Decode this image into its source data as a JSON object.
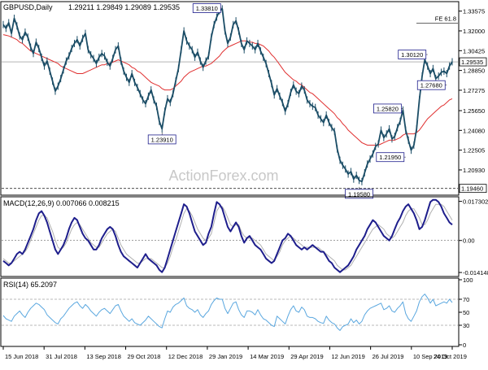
{
  "chart_data": [
    {
      "type": "line",
      "panel": "price",
      "title": "GBPUSD,Daily",
      "ohlc_text": "1.29211 1.29849 1.29089 1.29535",
      "watermark": "ActionForex.com",
      "ylim": [
        1.1905,
        1.342
      ],
      "y_ticks": [
        "1.33575",
        "1.32000",
        "1.30425",
        "1.28850",
        "1.27275",
        "1.25650",
        "1.24080",
        "1.22505",
        "1.20930",
        "1.19460"
      ],
      "y_tick_values": [
        1.33575,
        1.32,
        1.30425,
        1.2885,
        1.27275,
        1.2565,
        1.2408,
        1.22505,
        1.2093,
        1.1946
      ],
      "last_price_label": "1.29535",
      "last_price": 1.29535,
      "support_level": 1.1946,
      "fe_label": "FE 61.8",
      "fe_level": 1.3262,
      "callouts": [
        {
          "label": "1.33810",
          "value": 1.3381,
          "index": 80
        },
        {
          "label": "1.23910",
          "value": 1.2391,
          "index": 58
        },
        {
          "label": "1.30120",
          "value": 1.3012,
          "index": 155
        },
        {
          "label": "1.27680",
          "value": 1.2768,
          "index": 162
        },
        {
          "label": "1.25820",
          "value": 1.2582,
          "index": 146
        },
        {
          "label": "1.21950",
          "value": 1.2195,
          "index": 147
        },
        {
          "label": "1.19580",
          "value": 1.1958,
          "index": 130
        }
      ],
      "series": [
        {
          "role": "price",
          "values": [
            1.325,
            1.322,
            1.3265,
            1.318,
            1.33,
            1.324,
            1.316,
            1.313,
            1.319,
            1.315,
            1.307,
            1.302,
            1.311,
            1.306,
            1.299,
            1.292,
            1.296,
            1.288,
            1.28,
            1.272,
            1.276,
            1.282,
            1.289,
            1.296,
            1.3,
            1.306,
            1.31,
            1.313,
            1.308,
            1.314,
            1.318,
            1.305,
            1.301,
            1.298,
            1.294,
            1.299,
            1.302,
            1.3,
            1.295,
            1.292,
            1.298,
            1.305,
            1.308,
            1.296,
            1.288,
            1.283,
            1.279,
            1.286,
            1.279,
            1.275,
            1.27,
            1.265,
            1.262,
            1.268,
            1.273,
            1.265,
            1.26,
            1.248,
            1.242,
            1.256,
            1.266,
            1.263,
            1.27,
            1.28,
            1.29,
            1.305,
            1.32,
            1.312,
            1.308,
            1.305,
            1.299,
            1.303,
            1.296,
            1.291,
            1.296,
            1.3,
            1.315,
            1.325,
            1.331,
            1.336,
            1.3375,
            1.32,
            1.31,
            1.315,
            1.325,
            1.328,
            1.32,
            1.31,
            1.305,
            1.312,
            1.31,
            1.308,
            1.305,
            1.31,
            1.304,
            1.299,
            1.294,
            1.286,
            1.278,
            1.269,
            1.274,
            1.268,
            1.263,
            1.256,
            1.262,
            1.271,
            1.277,
            1.272,
            1.27,
            1.276,
            1.273,
            1.265,
            1.262,
            1.26,
            1.259,
            1.253,
            1.25,
            1.247,
            1.253,
            1.247,
            1.243,
            1.24,
            1.226,
            1.217,
            1.213,
            1.21,
            1.206,
            1.208,
            1.202,
            1.205,
            1.201,
            1.2,
            1.207,
            1.214,
            1.218,
            1.222,
            1.228,
            1.23,
            1.241,
            1.235,
            1.238,
            1.242,
            1.234,
            1.236,
            1.243,
            1.248,
            1.257,
            1.241,
            1.233,
            1.225,
            1.229,
            1.242,
            1.265,
            1.284,
            1.297,
            1.292,
            1.286,
            1.29,
            1.282,
            1.284,
            1.287,
            1.288,
            1.286,
            1.292,
            1.2954
          ]
        },
        {
          "role": "moving-average",
          "values": [
            1.317,
            1.3165,
            1.316,
            1.315,
            1.314,
            1.313,
            1.311,
            1.31,
            1.308,
            1.306,
            1.304,
            1.303,
            1.302,
            1.301,
            1.3,
            1.299,
            1.298,
            1.297,
            1.296,
            1.295,
            1.294,
            1.292,
            1.291,
            1.29,
            1.289,
            1.288,
            1.287,
            1.286,
            1.286,
            1.286,
            1.287,
            1.288,
            1.289,
            1.29,
            1.291,
            1.292,
            1.293,
            1.293,
            1.294,
            1.294,
            1.295,
            1.296,
            1.297,
            1.296,
            1.295,
            1.294,
            1.293,
            1.291,
            1.29,
            1.288,
            1.287,
            1.285,
            1.283,
            1.281,
            1.279,
            1.278,
            1.277,
            1.276,
            1.274,
            1.273,
            1.273,
            1.273,
            1.274,
            1.276,
            1.278,
            1.28,
            1.283,
            1.285,
            1.287,
            1.288,
            1.289,
            1.29,
            1.291,
            1.292,
            1.292,
            1.293,
            1.294,
            1.296,
            1.298,
            1.3,
            1.303,
            1.305,
            1.307,
            1.308,
            1.309,
            1.31,
            1.311,
            1.312,
            1.312,
            1.312,
            1.311,
            1.311,
            1.31,
            1.31,
            1.309,
            1.308,
            1.306,
            1.304,
            1.301,
            1.299,
            1.296,
            1.293,
            1.29,
            1.287,
            1.285,
            1.283,
            1.281,
            1.28,
            1.278,
            1.277,
            1.275,
            1.273,
            1.271,
            1.27,
            1.268,
            1.266,
            1.264,
            1.262,
            1.26,
            1.258,
            1.256,
            1.254,
            1.251,
            1.249,
            1.246,
            1.244,
            1.241,
            1.239,
            1.237,
            1.235,
            1.233,
            1.231,
            1.23,
            1.229,
            1.229,
            1.229,
            1.229,
            1.229,
            1.23,
            1.231,
            1.232,
            1.233,
            1.233,
            1.233,
            1.234,
            1.235,
            1.237,
            1.238,
            1.238,
            1.238,
            1.238,
            1.239,
            1.241,
            1.244,
            1.247,
            1.25,
            1.252,
            1.254,
            1.256,
            1.258,
            1.26,
            1.261,
            1.263,
            1.265,
            1.266
          ]
        }
      ]
    },
    {
      "type": "line",
      "panel": "macd",
      "title": "MACD(12,26,9) 0.007066 0.008215",
      "ylim": [
        -0.0152,
        0.0186
      ],
      "y_ticks": [
        "0.017302",
        "0.00",
        "-0.014148"
      ],
      "y_tick_values": [
        0.017302,
        0.0,
        -0.014148
      ],
      "series": [
        {
          "role": "macd",
          "values": [
            -0.009,
            -0.01,
            -0.011,
            -0.01,
            -0.008,
            -0.006,
            -0.005,
            -0.006,
            -0.004,
            -0.001,
            0.002,
            0.005,
            0.009,
            0.012,
            0.013,
            0.011,
            0.008,
            0.004,
            0.0,
            -0.004,
            -0.006,
            -0.004,
            -0.002,
            0.001,
            0.005,
            0.008,
            0.01,
            0.009,
            0.006,
            0.003,
            0.001,
            0.0,
            -0.002,
            -0.004,
            -0.004,
            -0.002,
            0.001,
            0.003,
            0.005,
            0.006,
            0.005,
            0.002,
            -0.002,
            -0.005,
            -0.007,
            -0.008,
            -0.009,
            -0.01,
            -0.011,
            -0.012,
            -0.01,
            -0.008,
            -0.006,
            -0.008,
            -0.009,
            -0.01,
            -0.011,
            -0.013,
            -0.014,
            -0.012,
            -0.008,
            -0.004,
            0.0,
            0.004,
            0.008,
            0.012,
            0.016,
            0.015,
            0.012,
            0.008,
            0.004,
            0.002,
            0.0,
            -0.002,
            -0.001,
            0.003,
            0.006,
            0.012,
            0.017,
            0.016,
            0.014,
            0.01,
            0.006,
            0.004,
            0.006,
            0.008,
            0.006,
            0.002,
            -0.001,
            0.001,
            0.002,
            0.0,
            -0.002,
            -0.003,
            -0.004,
            -0.006,
            -0.008,
            -0.009,
            -0.01,
            -0.009,
            -0.006,
            -0.003,
            0.0,
            0.001,
            0.003,
            0.002,
            0.0,
            -0.002,
            -0.003,
            -0.004,
            -0.003,
            -0.004,
            -0.003,
            -0.002,
            -0.003,
            -0.004,
            -0.005,
            -0.005,
            -0.007,
            -0.009,
            -0.01,
            -0.012,
            -0.013,
            -0.014,
            -0.013,
            -0.012,
            -0.011,
            -0.009,
            -0.007,
            -0.004,
            -0.002,
            0.0,
            0.002,
            0.005,
            0.007,
            0.009,
            0.008,
            0.006,
            0.004,
            0.002,
            0.001,
            0.0,
            0.002,
            0.005,
            0.008,
            0.01,
            0.013,
            0.015,
            0.016,
            0.014,
            0.012,
            0.009,
            0.005,
            0.006,
            0.009,
            0.013,
            0.017,
            0.018,
            0.018,
            0.017,
            0.015,
            0.012,
            0.01,
            0.008,
            0.007
          ]
        },
        {
          "role": "signal",
          "values": [
            -0.008,
            -0.009,
            -0.01,
            -0.01,
            -0.009,
            -0.008,
            -0.007,
            -0.006,
            -0.005,
            -0.003,
            0.0,
            0.003,
            0.006,
            0.009,
            0.011,
            0.011,
            0.01,
            0.007,
            0.004,
            0.0,
            -0.003,
            -0.004,
            -0.003,
            -0.001,
            0.002,
            0.005,
            0.007,
            0.008,
            0.007,
            0.005,
            0.003,
            0.001,
            -0.001,
            -0.002,
            -0.003,
            -0.003,
            -0.001,
            0.001,
            0.003,
            0.004,
            0.005,
            0.004,
            0.001,
            -0.002,
            -0.004,
            -0.006,
            -0.007,
            -0.008,
            -0.009,
            -0.01,
            -0.01,
            -0.009,
            -0.008,
            -0.008,
            -0.008,
            -0.009,
            -0.01,
            -0.011,
            -0.012,
            -0.012,
            -0.01,
            -0.007,
            -0.003,
            0.0,
            0.004,
            0.008,
            0.012,
            0.014,
            0.013,
            0.011,
            0.008,
            0.005,
            0.003,
            0.001,
            0.0,
            0.001,
            0.003,
            0.008,
            0.013,
            0.015,
            0.015,
            0.013,
            0.01,
            0.007,
            0.006,
            0.007,
            0.007,
            0.004,
            0.002,
            0.001,
            0.001,
            0.001,
            0.0,
            -0.001,
            -0.002,
            -0.004,
            -0.006,
            -0.007,
            -0.008,
            -0.009,
            -0.007,
            -0.005,
            -0.002,
            0.0,
            0.001,
            0.002,
            0.001,
            0.0,
            -0.001,
            -0.002,
            -0.003,
            -0.003,
            -0.003,
            -0.003,
            -0.003,
            -0.003,
            -0.004,
            -0.005,
            -0.006,
            -0.007,
            -0.008,
            -0.009,
            -0.011,
            -0.012,
            -0.013,
            -0.013,
            -0.012,
            -0.011,
            -0.009,
            -0.007,
            -0.005,
            -0.003,
            -0.001,
            0.001,
            0.003,
            0.005,
            0.006,
            0.007,
            0.006,
            0.005,
            0.003,
            0.002,
            0.001,
            0.002,
            0.004,
            0.006,
            0.008,
            0.011,
            0.013,
            0.014,
            0.014,
            0.012,
            0.01,
            0.007,
            0.007,
            0.009,
            0.012,
            0.014,
            0.016,
            0.016,
            0.016,
            0.015,
            0.013,
            0.011,
            0.009
          ]
        }
      ]
    },
    {
      "type": "line",
      "panel": "rsi",
      "title": "RSI(14) 65.2097",
      "ylim": [
        0,
        100
      ],
      "y_ticks": [
        "100",
        "70",
        "50",
        "30",
        "0"
      ],
      "y_tick_values": [
        100,
        70,
        50,
        30,
        0
      ],
      "levels": [
        70,
        30
      ],
      "series": [
        {
          "role": "rsi",
          "values": [
            45,
            40,
            38,
            36,
            44,
            48,
            52,
            46,
            42,
            50,
            56,
            60,
            64,
            62,
            58,
            54,
            46,
            42,
            38,
            34,
            32,
            40,
            44,
            50,
            56,
            60,
            64,
            66,
            60,
            56,
            62,
            58,
            52,
            48,
            44,
            50,
            54,
            56,
            52,
            48,
            54,
            60,
            62,
            52,
            44,
            40,
            36,
            40,
            34,
            32,
            30,
            34,
            38,
            44,
            40,
            36,
            32,
            28,
            26,
            40,
            52,
            50,
            58,
            62,
            64,
            68,
            72,
            60,
            56,
            54,
            50,
            54,
            46,
            42,
            48,
            52,
            62,
            68,
            72,
            70,
            70,
            56,
            48,
            56,
            64,
            66,
            54,
            46,
            42,
            52,
            52,
            50,
            46,
            54,
            46,
            40,
            38,
            34,
            30,
            28,
            44,
            40,
            36,
            32,
            44,
            54,
            60,
            52,
            50,
            58,
            54,
            44,
            42,
            42,
            40,
            36,
            34,
            33,
            44,
            38,
            34,
            32,
            26,
            22,
            28,
            30,
            32,
            40,
            34,
            38,
            32,
            36,
            46,
            52,
            56,
            58,
            60,
            62,
            64,
            54,
            56,
            60,
            52,
            50,
            56,
            60,
            66,
            48,
            40,
            36,
            44,
            52,
            66,
            74,
            78,
            72,
            64,
            70,
            60,
            62,
            64,
            66,
            64,
            70,
            65
          ]
        }
      ]
    }
  ],
  "x_axis": {
    "count": 165,
    "labels": [
      {
        "text": "15 Jun 2018",
        "index": 0
      },
      {
        "text": "31 Jul 2018",
        "index": 16
      },
      {
        "text": "13 Sep 2018",
        "index": 32
      },
      {
        "text": "29 Oct 2018",
        "index": 48
      },
      {
        "text": "12 Dec 2018",
        "index": 64
      },
      {
        "text": "29 Jan 2019",
        "index": 80
      },
      {
        "text": "14 Mar 2019",
        "index": 96
      },
      {
        "text": "29 Apr 2019",
        "index": 112
      },
      {
        "text": "12 Jun 2019",
        "index": 128
      },
      {
        "text": "26 Jul 2019",
        "index": 144
      },
      {
        "text": "10 Sep 2019",
        "index": 160
      },
      {
        "text": "24 Oct 2019",
        "index": 176
      }
    ]
  },
  "colors": {
    "price": "#1b4d66",
    "moving_average": "#e03030",
    "macd": "#1e1e8c",
    "signal": "#b0b0b0",
    "rsi": "#5aa7df",
    "grid": "#d8d8d8",
    "axis_text": "#000000",
    "frame": "#000000",
    "callout_border": "#1e1e8c",
    "watermark": "#c8c8c8"
  }
}
